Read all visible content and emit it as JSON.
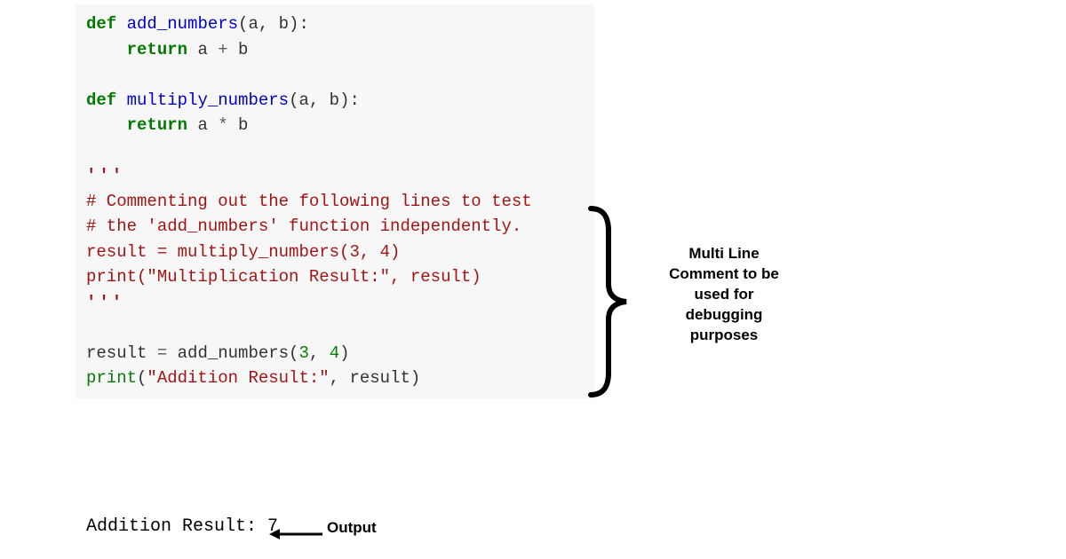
{
  "code": {
    "def1": "def",
    "fn1": "add_numbers",
    "sig1": "(a, b):",
    "ret1": "return",
    "expr1_a": "a ",
    "expr1_op": "+",
    "expr1_b": " b",
    "def2": "def",
    "fn2": "multiply_numbers",
    "sig2": "(a, b):",
    "ret2": "return",
    "expr2_a": "a ",
    "expr2_op": "*",
    "expr2_b": " b",
    "tick1": "'''",
    "c1": "# Commenting out the following lines to test",
    "c2": "# the 'add_numbers' function independently.",
    "c3": "result = multiply_numbers(3, 4)",
    "c4a": "print(",
    "c4b": "\"Multiplication Result:\"",
    "c4c": ", result)",
    "tick2": "'''",
    "r1a": "result ",
    "r1b": "=",
    "r1c": " add_numbers(",
    "r1d": "3",
    "r1e": ", ",
    "r1f": "4",
    "r1g": ")",
    "p1a": "print",
    "p1b": "(",
    "p1c": "\"Addition Result:\"",
    "p1d": ", result)"
  },
  "output": {
    "text": "Addition Result: 7",
    "label": "Output"
  },
  "annotation": {
    "line1": "Multi Line",
    "line2": "Comment to be",
    "line3": "used for",
    "line4": "debugging",
    "line5": "purposes"
  }
}
